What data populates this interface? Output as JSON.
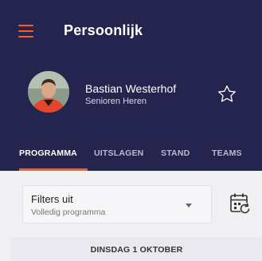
{
  "header": {
    "title": "Persoonlijk",
    "background": "#25244f",
    "accent": "#ff5c1a"
  },
  "profile": {
    "name": "Bastian Westerhof",
    "team": "Senioren Heren"
  },
  "tabs": [
    {
      "label": "PROGRAMMA",
      "active": true
    },
    {
      "label": "UITSLAGEN",
      "active": false
    },
    {
      "label": "STAND",
      "active": false
    },
    {
      "label": "TEAMS",
      "active": false
    }
  ],
  "filter": {
    "title": "Filters uit",
    "subtitle": "Volledig programma"
  },
  "schedule": {
    "date_label": "DINSDAG 1 OKTOBER"
  },
  "icons": {
    "menu": "hamburger-menu-icon",
    "favorite": "star-outline-icon",
    "calendar": "calendar-refresh-icon",
    "dropdown": "caret-down-icon"
  }
}
